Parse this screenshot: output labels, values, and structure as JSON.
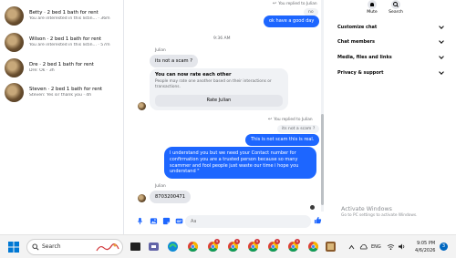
{
  "conversations": [
    {
      "name": "Betty · 2 bed 1 bath for rent",
      "last": "You are interested in this listin... · 36m"
    },
    {
      "name": "Wilson · 2 bed 1 bath for rent",
      "last": "You are interested in this listin... · 57m"
    },
    {
      "name": "Dre · 2 bed 1 bath for rent",
      "last": "Dre: Ok · 3h"
    },
    {
      "name": "Steven · 2 bed 1 bath for rent",
      "last": "Steven: Yes sir thank you · 4h"
    }
  ],
  "chat": {
    "top_replied": "You replied to Julian",
    "top_quote": "no",
    "msg_good_day": "ok have a good day",
    "time_separator": "9:36 AM",
    "sender_julian_1": "Julian",
    "msg_scam_question": "its not a scam ?",
    "rate_card": {
      "title": "You can now rate each other",
      "description": "People may rate one another based on their interactions or transactions.",
      "button": "Rate Julian"
    },
    "mid_replied": "You replied to Julian",
    "mid_quote": "its not a scam ?",
    "msg_not_scam": "This is not scam this is real.",
    "msg_long": "I understand you but we need your Contact number for confirmation you are a trusted person because so many scammer and fool people just waste our time i hope you understand \"",
    "sender_julian_2": "Julian",
    "msg_number": "8703200471"
  },
  "composer": {
    "placeholder": "Aa"
  },
  "info_panel": {
    "mute": "Mute",
    "search": "Search",
    "rows": [
      "Customize chat",
      "Chat members",
      "Media, files and links",
      "Privacy & support"
    ]
  },
  "watermark": {
    "title": "Activate Windows",
    "subtitle": "Go to PC settings to activate Windows."
  },
  "taskbar": {
    "search_label": "Search",
    "time": "9:05 PM",
    "date": "4/6/2026",
    "language": "ENG",
    "notification_count": "3",
    "chrome_badges": [
      "9",
      "9",
      "9",
      "9",
      "9"
    ]
  },
  "colors": {
    "accent": "#1d66ff",
    "bubble_in": "#e4e6eb"
  }
}
